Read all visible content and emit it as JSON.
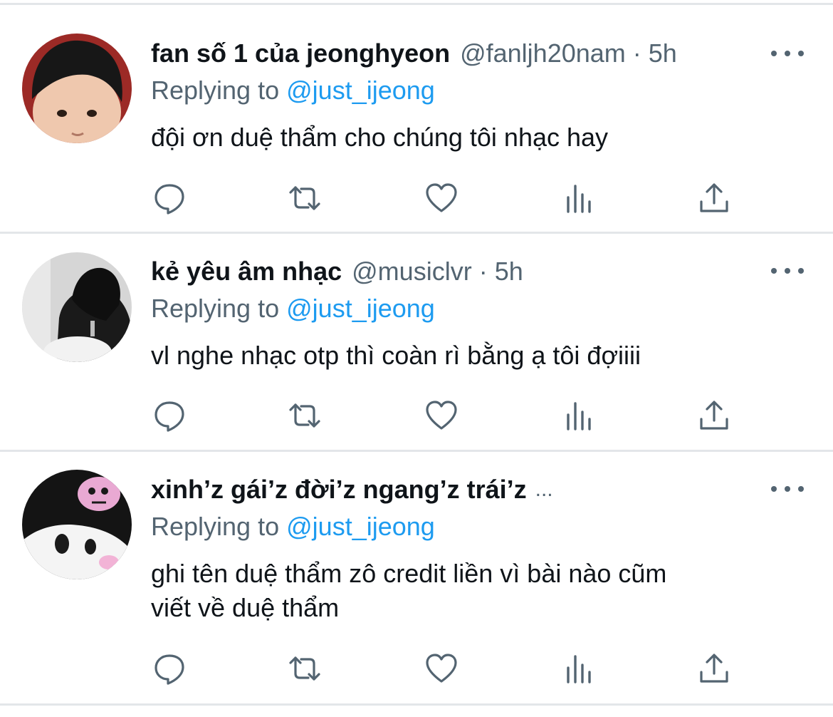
{
  "tweets": [
    {
      "name": "fan số 1 của jeonghyeon",
      "handle": "@fanljh20nam",
      "separator": "·",
      "time": "5h",
      "replying_prefix": "Replying to",
      "replying_handle": "@just_ijeong",
      "text": "đội ơn duệ thẩm cho chúng tôi nhạc hay",
      "avatar": "child-photo"
    },
    {
      "name": "kẻ yêu âm nhạc",
      "handle": "@musiclvr",
      "separator": "·",
      "time": "5h",
      "replying_prefix": "Replying to",
      "replying_handle": "@just_ijeong",
      "text": "vl nghe nhạc otp thì coàn rì bằng ạ tôi đợiiii",
      "avatar": "hooded-figure-photo"
    },
    {
      "name": "xinh’z gái’z đời’z ngang’z trái’z",
      "truncation": "...",
      "replying_prefix": "Replying to",
      "replying_handle": "@just_ijeong",
      "text_lines": [
        "ghi tên duệ thẩm zô credit liền vì bài nào cũm",
        "viết về duệ thẩm"
      ],
      "avatar": "kuromi-photo"
    }
  ],
  "icons": {
    "reply": "reply-icon",
    "retweet": "retweet-icon",
    "like": "like-icon",
    "views": "views-icon",
    "share": "share-icon",
    "more": "more-icon"
  },
  "colors": {
    "link": "#1d9bf0",
    "secondary": "#536471",
    "text": "#0f1419",
    "divider": "#e3e6e9"
  }
}
